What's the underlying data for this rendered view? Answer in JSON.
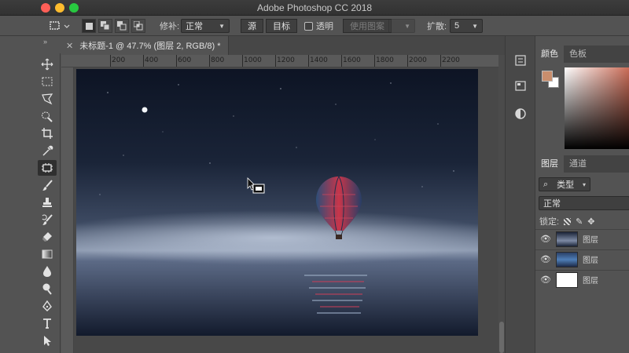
{
  "window": {
    "title": "Adobe Photoshop CC 2018"
  },
  "options_bar": {
    "feather_label": "修补:",
    "mode_value": "正常",
    "source_label": "源",
    "target_label": "目标",
    "transparent_label": "透明",
    "use_pattern_label": "使用图案",
    "spread_label": "扩散:",
    "spread_value": "5"
  },
  "document": {
    "tab_title": "未标题-1 @ 47.7% (图层 2, RGB/8) *",
    "ruler_labels": [
      "200",
      "400",
      "600",
      "800",
      "1000",
      "1200",
      "1400",
      "1600",
      "1800",
      "2000",
      "2200"
    ]
  },
  "panels": {
    "color_tab": "颜色",
    "swatches_tab": "色板",
    "foreground_color": "#c98e6d",
    "background_color": "#ffffff",
    "layers_tab": "图层",
    "channels_tab": "通道",
    "filter_kind": "类型",
    "blend_mode": "正常",
    "lock_label": "锁定:",
    "layers": [
      {
        "name": "图层",
        "visible": true
      },
      {
        "name": "图层",
        "visible": true
      },
      {
        "name": "图层",
        "visible": true
      }
    ]
  },
  "tools": [
    "move-tool",
    "marquee-tool",
    "lasso-tool",
    "quick-select-tool",
    "crop-tool",
    "eyedropper-tool",
    "patch-tool",
    "brush-tool",
    "clone-stamp-tool",
    "history-brush-tool",
    "eraser-tool",
    "gradient-tool",
    "blur-tool",
    "dodge-tool",
    "pen-tool",
    "type-tool",
    "path-select-tool"
  ]
}
